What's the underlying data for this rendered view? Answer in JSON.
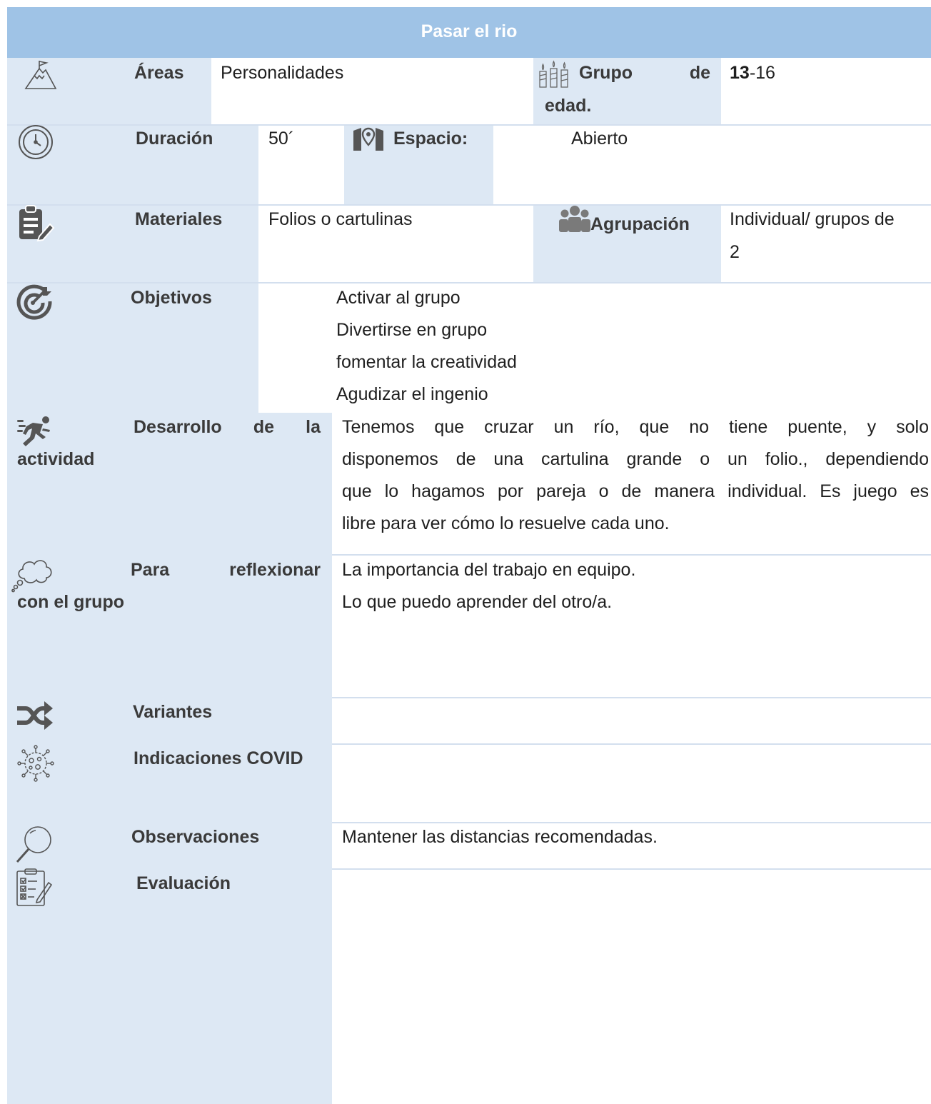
{
  "header": {
    "title": "Pasar el rio"
  },
  "areas": {
    "label": "Áreas",
    "value": "Personalidades"
  },
  "edad": {
    "label_line1": "Grupo de",
    "label_line2": "edad.",
    "value_bold": "13",
    "value_rest": "-16"
  },
  "duracion": {
    "label": "Duración",
    "value": "50´"
  },
  "espacio": {
    "label": "Espacio:",
    "value": "Abierto"
  },
  "materiales": {
    "label": "Materiales",
    "value": "Folios o  cartulinas"
  },
  "agrupacion": {
    "label": "Agrupación",
    "value_line1": "Individual/ grupos de",
    "value_line2": "2"
  },
  "objetivos": {
    "label": "Objetivos",
    "items": [
      "Activar al  grupo",
      "Divertirse en  grupo",
      "fomentar la creatividad",
      "Agudizar el  ingenio"
    ]
  },
  "desarrollo": {
    "label_line1": "Desarrollo de la",
    "label_line2": "actividad",
    "lines": [
      "Tenemos que cruzar un río, que no tiene puente, y solo",
      "disponemos de una cartulina grande o un folio., dependiendo",
      "que lo hagamos por pareja o de manera individual. Es juego es",
      "libre para ver cómo lo resuelve cada uno."
    ]
  },
  "reflexionar": {
    "label_line1": "Para reflexionar",
    "label_line2": "con el grupo",
    "lines": [
      "La importancia del trabajo en equipo.",
      "Lo que puedo aprender del otro/a."
    ]
  },
  "variantes": {
    "label": "Variantes"
  },
  "covid": {
    "label": "Indicaciones COVID"
  },
  "observaciones": {
    "label": "Observaciones",
    "value": "Mantener las distancias recomendadas."
  },
  "evaluacion": {
    "label": "Evaluación"
  },
  "colors": {
    "header": "#9fc3e6",
    "cell": "#dde8f4",
    "icon": "#555555",
    "rule": "#d3dfee"
  }
}
